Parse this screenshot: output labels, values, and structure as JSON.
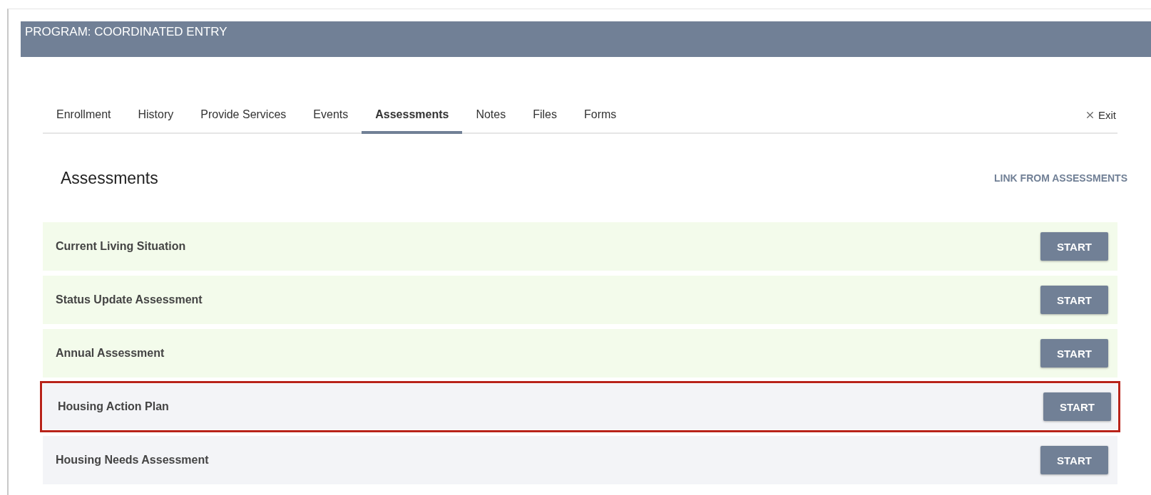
{
  "program_bar": {
    "title": "PROGRAM: COORDINATED ENTRY"
  },
  "tabs": [
    {
      "label": "Enrollment",
      "selected": false
    },
    {
      "label": "History",
      "selected": false
    },
    {
      "label": "Provide Services",
      "selected": false
    },
    {
      "label": "Events",
      "selected": false
    },
    {
      "label": "Assessments",
      "selected": true
    },
    {
      "label": "Notes",
      "selected": false
    },
    {
      "label": "Files",
      "selected": false
    },
    {
      "label": "Forms",
      "selected": false
    }
  ],
  "exit": {
    "label": "Exit"
  },
  "section": {
    "title": "Assessments",
    "link": "LINK FROM ASSESSMENTS"
  },
  "assessments": [
    {
      "name": "Current Living Situation",
      "color": "#f3fbeb",
      "highlighted": false,
      "button": "START"
    },
    {
      "name": "Status Update Assessment",
      "color": "#f3fbeb",
      "highlighted": false,
      "button": "START"
    },
    {
      "name": "Annual Assessment",
      "color": "#f3fbeb",
      "highlighted": false,
      "button": "START"
    },
    {
      "name": "Housing Action Plan",
      "color": "#f3f4f7",
      "highlighted": true,
      "button": "START"
    },
    {
      "name": "Housing Needs Assessment",
      "color": "#f3f4f7",
      "highlighted": false,
      "button": "START"
    }
  ]
}
